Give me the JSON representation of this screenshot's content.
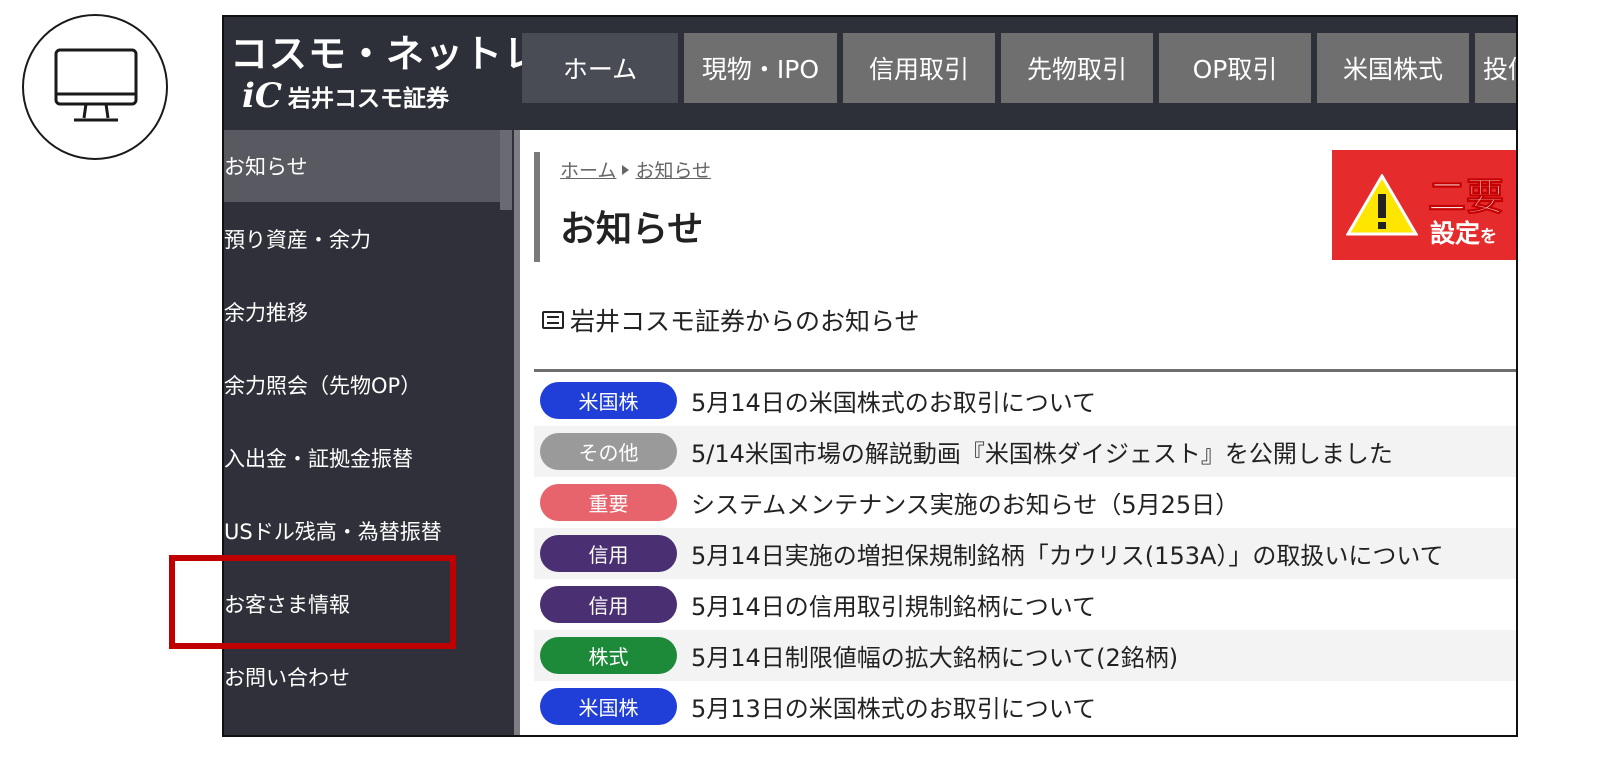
{
  "brand": {
    "name": "コスモ・ネットレ",
    "mark": "iC",
    "company": "岩井コスモ証券"
  },
  "nav": {
    "tabs": [
      {
        "label": "ホーム",
        "active": true
      },
      {
        "label": "現物・IPO"
      },
      {
        "label": "信用取引"
      },
      {
        "label": "先物取引"
      },
      {
        "label": "OP取引"
      },
      {
        "label": "米国株式"
      },
      {
        "label": "投信"
      }
    ]
  },
  "sidebar": {
    "items": [
      {
        "label": "お知らせ",
        "active": true
      },
      {
        "label": "預り資産・余力"
      },
      {
        "label": "余力推移"
      },
      {
        "label": "余力照会（先物OP）"
      },
      {
        "label": "入出金・証拠金振替"
      },
      {
        "label": "USドル残高・為替振替"
      },
      {
        "label": "お客さま情報"
      },
      {
        "label": "お問い合わせ"
      }
    ]
  },
  "breadcrumb": {
    "home": "ホーム",
    "current": "お知らせ"
  },
  "page": {
    "title": "お知らせ"
  },
  "alert": {
    "line1": "二要",
    "line2": "設定",
    "line2_tail": "を"
  },
  "section": {
    "heading": "岩井コスモ証券からのお知らせ"
  },
  "news": [
    {
      "tag": "米国株",
      "tag_color": "#1f3fd8",
      "title": "5月14日の米国株式のお取引について"
    },
    {
      "tag": "その他",
      "tag_color": "#9a9a9a",
      "title": "5/14米国市場の解説動画『米国株ダイジェスト』を公開しました"
    },
    {
      "tag": "重要",
      "tag_color": "#e8646c",
      "title": "システムメンテナンス実施のお知らせ（5月25日）"
    },
    {
      "tag": "信用",
      "tag_color": "#4a2f72",
      "title": "5月14日実施の増担保規制銘柄「カウリス(153A）」の取扱いについて"
    },
    {
      "tag": "信用",
      "tag_color": "#4a2f72",
      "title": "5月14日の信用取引規制銘柄について"
    },
    {
      "tag": "株式",
      "tag_color": "#1d8a3a",
      "title": "5月14日制限値幅の拡大銘柄について(2銘柄)"
    },
    {
      "tag": "米国株",
      "tag_color": "#1f3fd8",
      "title": "5月13日の米国株式のお取引について"
    }
  ],
  "colors": {
    "header_bg": "#2e3039",
    "sidebar_bg": "#2f3039",
    "highlight": "#c00000",
    "alert_bg": "#e52b2b"
  }
}
